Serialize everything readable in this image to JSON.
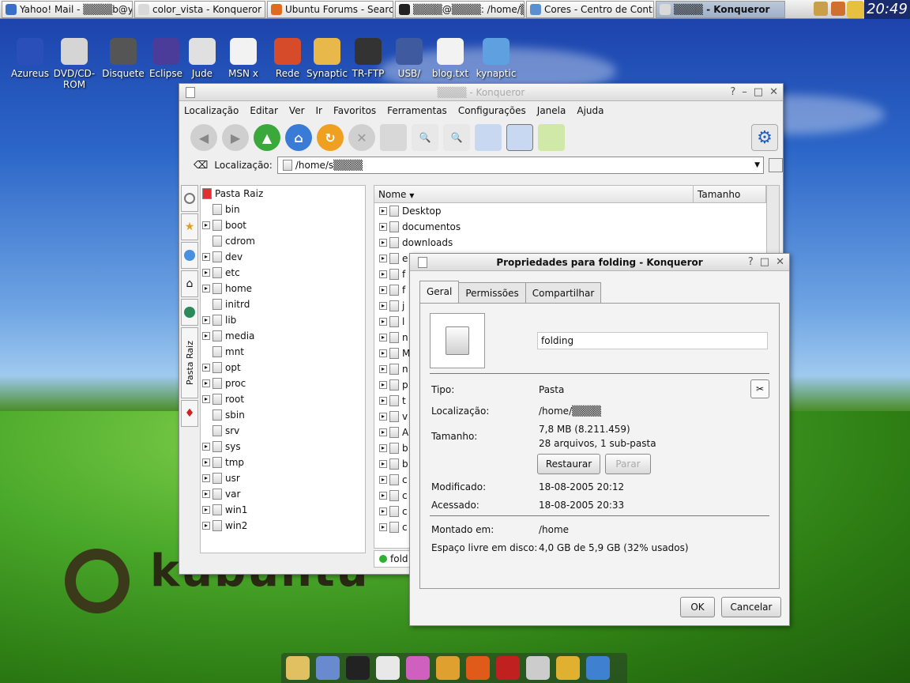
{
  "taskbar": {
    "tasks": [
      {
        "label": "Yahoo! Mail - ▒▒▒▒b@y▒",
        "color": "#3a6fc9"
      },
      {
        "label": "color_vista - Konqueror",
        "color": "#d9d9d9"
      },
      {
        "label": "Ubuntu Forums - Search R",
        "color": "#e06b1f"
      },
      {
        "label": "▒▒▒▒@▒▒▒▒: /home/▒▒",
        "color": "#222222"
      },
      {
        "label": "Cores - Centro de Controle",
        "color": "#5a8fd0"
      },
      {
        "label": "▒▒▒▒ - Konqueror",
        "color": "#d9d9d9"
      }
    ],
    "clock": "20:49"
  },
  "desktop_icons": [
    {
      "label": "Azureus",
      "color": "#2a4fb8"
    },
    {
      "label": "DVD/CD-ROM",
      "color": "#d5d5d5"
    },
    {
      "label": "Disquete",
      "color": "#555555"
    },
    {
      "label": "Eclipse",
      "color": "#4b3c9a"
    },
    {
      "label": "Jude",
      "color": "#e0e0e0"
    },
    {
      "label": "MSN x",
      "color": "#f2f2f2"
    },
    {
      "label": "Rede",
      "color": "#d64b2a"
    },
    {
      "label": "Synaptic",
      "color": "#e8b84a"
    },
    {
      "label": "TR-FTP",
      "color": "#333333"
    },
    {
      "label": "USB/",
      "color": "#3f5a9e"
    },
    {
      "label": "blog.txt",
      "color": "#f2f2f2"
    },
    {
      "label": "kynaptic",
      "color": "#5ea0e0"
    }
  ],
  "konqueror": {
    "title": "▒▒▒▒ - Konqueror",
    "menu": [
      "Localização",
      "Editar",
      "Ver",
      "Ir",
      "Favoritos",
      "Ferramentas",
      "Configurações",
      "Janela",
      "Ajuda"
    ],
    "location_label": "Localização:",
    "location_value": "/home/s▒▒▒▒",
    "sidetab_label": "Pasta Raiz",
    "tree_root": "Pasta Raiz",
    "tree": [
      {
        "name": "bin",
        "expandable": false
      },
      {
        "name": "boot",
        "expandable": true
      },
      {
        "name": "cdrom",
        "expandable": false
      },
      {
        "name": "dev",
        "expandable": true
      },
      {
        "name": "etc",
        "expandable": true
      },
      {
        "name": "home",
        "expandable": true
      },
      {
        "name": "initrd",
        "expandable": false
      },
      {
        "name": "lib",
        "expandable": true
      },
      {
        "name": "media",
        "expandable": true
      },
      {
        "name": "mnt",
        "expandable": false
      },
      {
        "name": "opt",
        "expandable": true
      },
      {
        "name": "proc",
        "expandable": true
      },
      {
        "name": "root",
        "expandable": true
      },
      {
        "name": "sbin",
        "expandable": false
      },
      {
        "name": "srv",
        "expandable": false
      },
      {
        "name": "sys",
        "expandable": true
      },
      {
        "name": "tmp",
        "expandable": true
      },
      {
        "name": "usr",
        "expandable": true
      },
      {
        "name": "var",
        "expandable": true
      },
      {
        "name": "win1",
        "expandable": true
      },
      {
        "name": "win2",
        "expandable": true
      }
    ],
    "columns": [
      "Nome",
      "Tamanho"
    ],
    "files": [
      "Desktop",
      "documentos",
      "downloads",
      "e",
      "f",
      "f",
      "j",
      "l",
      "n",
      "M",
      "n",
      "p",
      "t",
      "v",
      "A",
      "b",
      "b",
      "c",
      "c",
      "c",
      "c"
    ],
    "status": "fold"
  },
  "dialog": {
    "title": "Propriedades para folding - Konqueror",
    "tabs": [
      "Geral",
      "Permissões",
      "Compartilhar"
    ],
    "name_value": "folding",
    "tipo_label": "Tipo:",
    "tipo_value": "Pasta",
    "loc_label": "Localização:",
    "loc_value": "/home/▒▒▒▒",
    "size_label": "Tamanho:",
    "size_value": "7,8 MB (8.211.459)",
    "size_detail": "28 arquivos, 1 sub-pasta",
    "restaurar": "Restaurar",
    "parar": "Parar",
    "mod_label": "Modificado:",
    "mod_value": "18-08-2005 20:12",
    "acc_label": "Acessado:",
    "acc_value": "18-08-2005 20:33",
    "mount_label": "Montado em:",
    "mount_value": "/home",
    "free_label": "Espaço livre em disco:",
    "free_value": "4,0 GB de 5,9 GB (32% usados)",
    "ok": "OK",
    "cancel": "Cancelar"
  },
  "wallpaper_text": "kubuntu",
  "dock_colors": [
    "#e0c060",
    "#6a8ad0",
    "#222222",
    "#e8e8e8",
    "#d060c0",
    "#e0a030",
    "#e05a1a",
    "#c02020",
    "#cccccc",
    "#e0b030",
    "#4080d0"
  ]
}
